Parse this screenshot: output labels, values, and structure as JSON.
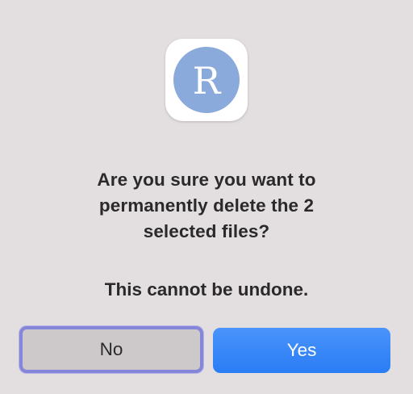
{
  "dialog": {
    "app_icon": {
      "name": "r-app-icon",
      "letter": "R",
      "circle_color": "#8aaadb"
    },
    "message_lines": [
      "Are you sure you want to",
      "permanently delete the 2",
      "selected files?"
    ],
    "warning": "This cannot be undone.",
    "buttons": {
      "no_label": "No",
      "yes_label": "Yes"
    },
    "colors": {
      "background": "#e3dfe0",
      "primary_button": "#2a7df5",
      "focus_ring": "#8586d9"
    }
  }
}
